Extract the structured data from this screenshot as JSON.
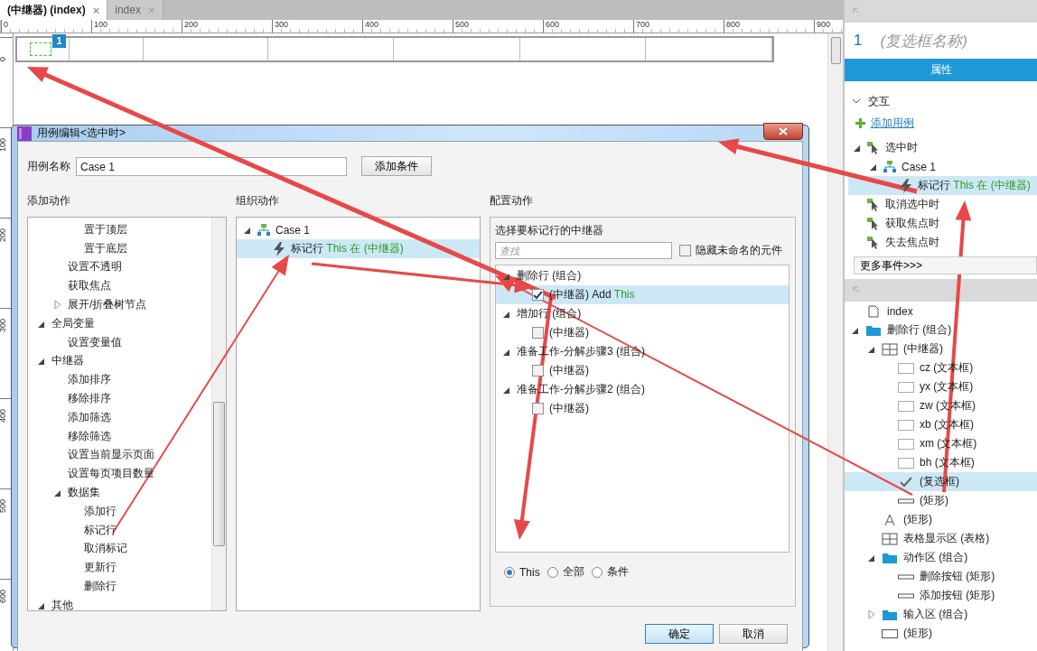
{
  "tabs": [
    {
      "label": "(中继器) (index)",
      "close": "×",
      "selected": true
    },
    {
      "label": "index",
      "close": "×",
      "selected": false
    }
  ],
  "ruler": {
    "horizontal": [
      "0",
      "100",
      "200",
      "300",
      "400",
      "500",
      "600",
      "700",
      "800",
      "900"
    ],
    "vertical": [
      "0",
      "100",
      "200",
      "300",
      "400",
      "500",
      "600"
    ]
  },
  "canvas": {
    "badge": "1"
  },
  "dialog": {
    "title": "用例编辑<选中时>",
    "case_name_label": "用例名称",
    "case_name_value": "Case 1",
    "add_condition_button": "添加条件",
    "add_actions": {
      "heading": "添加动作",
      "items": [
        {
          "children": [
            {
              "children": [
                {
                  "label": "置于顶层"
                },
                {
                  "label": "置于底层"
                }
              ]
            },
            {
              "label": "设置不透明"
            },
            {
              "label": "获取焦点"
            },
            {
              "label": "展开/折叠树节点",
              "expanded": false
            }
          ]
        },
        {
          "label": "全局变量",
          "expanded": true,
          "children": [
            {
              "label": "设置变量值"
            }
          ]
        },
        {
          "label": "中继器",
          "expanded": true,
          "children": [
            {
              "label": "添加排序"
            },
            {
              "label": "移除排序"
            },
            {
              "label": "添加筛选"
            },
            {
              "label": "移除筛选"
            },
            {
              "label": "设置当前显示页面"
            },
            {
              "label": "设置每页项目数量"
            },
            {
              "label": "数据集",
              "expanded": true,
              "children": [
                {
                  "label": "添加行"
                },
                {
                  "label": "标记行"
                },
                {
                  "label": "取消标记"
                },
                {
                  "label": "更新行"
                },
                {
                  "label": "删除行"
                }
              ]
            }
          ]
        },
        {
          "label": "其他",
          "expanded": true
        }
      ]
    },
    "organize_actions": {
      "heading": "组织动作",
      "case": {
        "label": "Case 1",
        "expanded": true
      },
      "action": {
        "label": "标记行",
        "detail": "This 在 (中继器)",
        "selected": true
      }
    },
    "configure_actions": {
      "heading": "配置动作",
      "subheading": "选择要标记行的中继器",
      "search": {
        "placeholder": "查找"
      },
      "hide_unnamed": {
        "label": "隐藏未命名的元件",
        "checked": false
      },
      "groups": [
        {
          "label": "删除行 (组合)",
          "expanded": true,
          "children": [
            {
              "label": "(中继器)",
              "detail": "Add",
              "target": "This",
              "checked": true,
              "selected": true
            }
          ]
        },
        {
          "label": "增加行 (组合)",
          "expanded": true,
          "children": [
            {
              "label": "(中继器)",
              "checked": false,
              "selected": false
            }
          ]
        },
        {
          "label": "准备工作-分解步骤3 (组合)",
          "expanded": true,
          "children": [
            {
              "label": "(中继器)",
              "checked": false,
              "selected": false
            }
          ]
        },
        {
          "label": "准备工作-分解步骤2 (组合)",
          "expanded": true,
          "children": [
            {
              "label": "(中继器)",
              "checked": false,
              "selected": false
            }
          ]
        }
      ],
      "radios": [
        {
          "label": "This",
          "selected": true
        },
        {
          "label": "全部",
          "selected": false
        },
        {
          "label": "条件",
          "selected": false
        }
      ]
    },
    "buttons": [
      "确定",
      "取消"
    ]
  },
  "inspector": {
    "number": "1",
    "name_placeholder": "(复选框名称)",
    "tab": "属性",
    "section": "交互",
    "add_case_link": "添加用例",
    "events": [
      {
        "kind": "event",
        "label": "选中时",
        "expanded": true,
        "children": [
          {
            "kind": "case",
            "label": "Case 1",
            "expanded": true,
            "children": [
              {
                "kind": "action",
                "label": "标记行",
                "detail": "This 在 (中继器)",
                "selected": true
              }
            ]
          }
        ]
      },
      {
        "kind": "event",
        "label": "取消选中时"
      },
      {
        "kind": "event",
        "label": "获取焦点时"
      },
      {
        "kind": "event",
        "label": "失去焦点时"
      }
    ],
    "more_events": "更多事件>>>"
  },
  "outline": [
    {
      "kind": "page",
      "label": "index"
    },
    {
      "kind": "folder",
      "label": "删除行 (组合)",
      "expanded": true,
      "children": [
        {
          "kind": "repeater",
          "label": "(中继器)",
          "expanded": true,
          "children": [
            {
              "kind": "textbox",
              "label": "cz (文本框)"
            },
            {
              "kind": "textbox",
              "label": "yx (文本框)"
            },
            {
              "kind": "textbox",
              "label": "zw (文本框)"
            },
            {
              "kind": "textbox",
              "label": "xb (文本框)"
            },
            {
              "kind": "textbox",
              "label": "xm (文本框)"
            },
            {
              "kind": "textbox",
              "label": "bh (文本框)"
            },
            {
              "kind": "checkbox",
              "label": "(复选框)",
              "selected": true
            },
            {
              "kind": "line",
              "label": "(矩形)"
            }
          ]
        },
        {
          "kind": "text",
          "label": "(矩形)"
        },
        {
          "kind": "table",
          "label": "表格显示区 (表格)"
        },
        {
          "kind": "folder",
          "label": "动作区 (组合)",
          "expanded": true,
          "children": [
            {
              "kind": "line",
              "label": "删除按钮 (矩形)"
            },
            {
              "kind": "line",
              "label": "添加按钮 (矩形)"
            }
          ]
        },
        {
          "kind": "folder",
          "label": "输入区 (组合)",
          "expanded": false
        },
        {
          "kind": "rect",
          "label": "(矩形)"
        }
      ]
    }
  ]
}
